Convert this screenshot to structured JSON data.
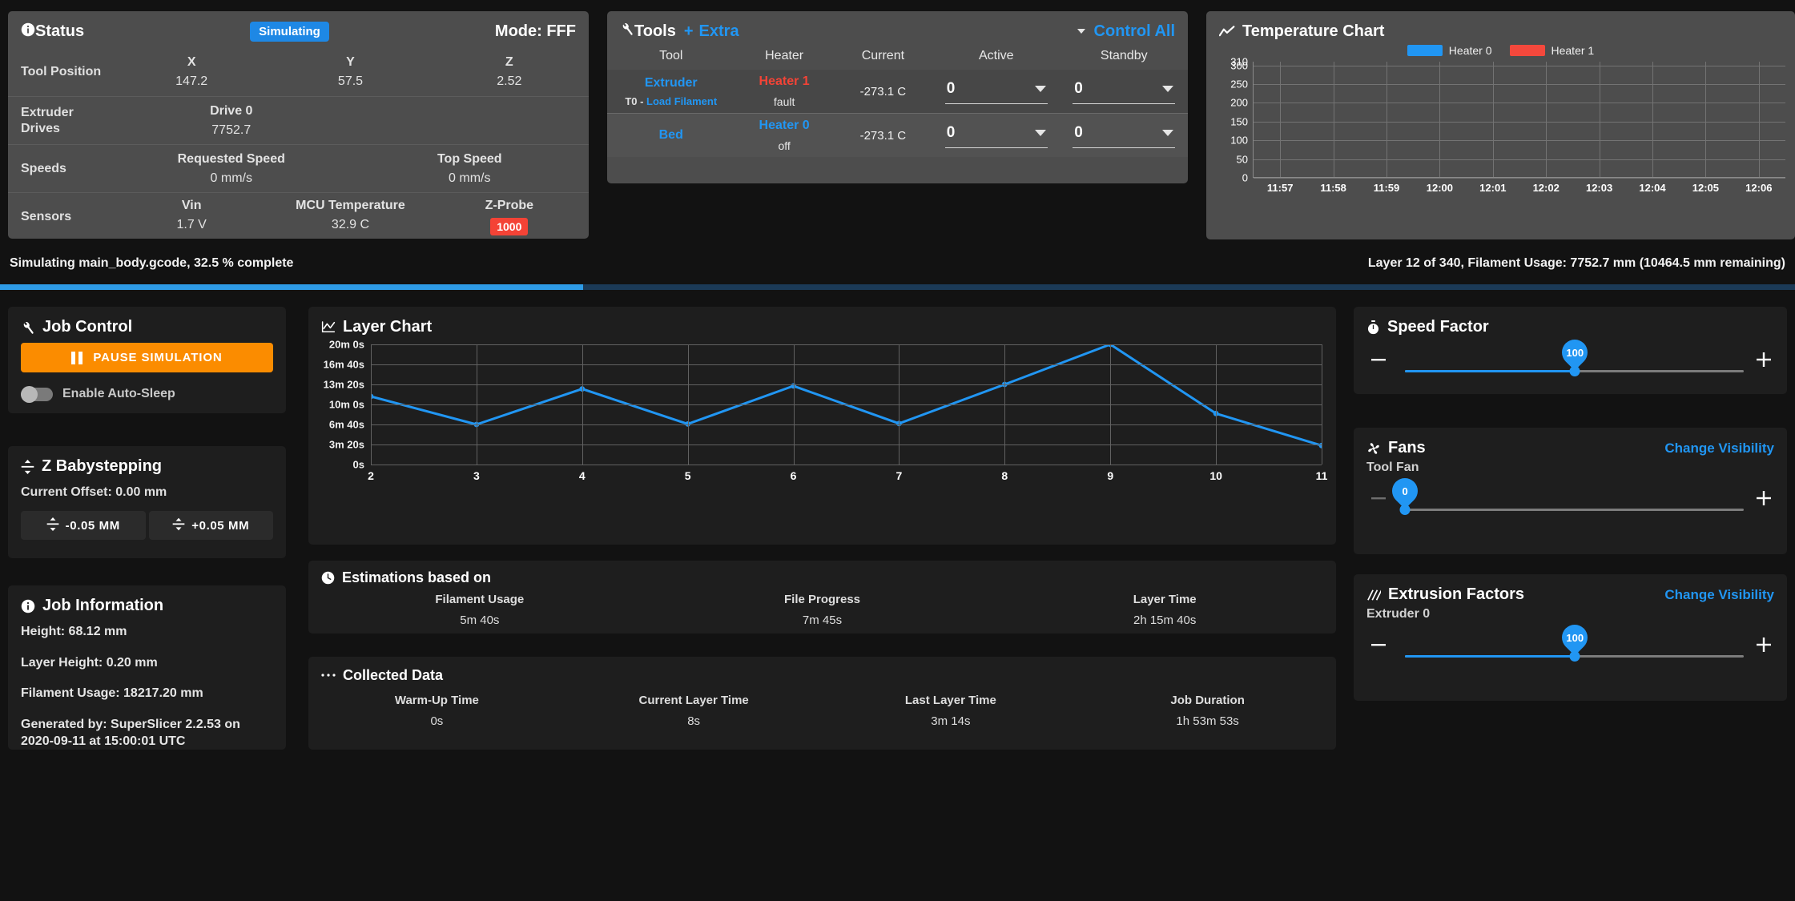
{
  "status": {
    "title": "Status",
    "badge": "Simulating",
    "mode": "Mode: FFF",
    "rows": [
      {
        "label": "Tool Position",
        "cells": [
          {
            "k": "X",
            "v": "147.2"
          },
          {
            "k": "Y",
            "v": "57.5"
          },
          {
            "k": "Z",
            "v": "2.52"
          }
        ]
      },
      {
        "label": "Extruder Drives",
        "label_line1": "Extruder",
        "label_line2": "Drives",
        "cells": [
          {
            "k": "Drive 0",
            "v": "7752.7"
          }
        ]
      },
      {
        "label": "Speeds",
        "cells": [
          {
            "k": "Requested Speed",
            "v": "0 mm/s"
          },
          {
            "k": "Top Speed",
            "v": "0 mm/s"
          }
        ]
      },
      {
        "label": "Sensors",
        "cells": [
          {
            "k": "Vin",
            "v": "1.7 V"
          },
          {
            "k": "MCU Temperature",
            "v": "32.9 C"
          },
          {
            "k": "Z-Probe",
            "v": "1000",
            "chip": "red"
          }
        ]
      }
    ]
  },
  "tools": {
    "title": "Tools",
    "extra_plus": "+",
    "extra": "Extra",
    "control_all": "Control All",
    "columns": [
      "Tool",
      "Heater",
      "Current",
      "Active",
      "Standby"
    ],
    "rows": [
      {
        "tool": "Extruder",
        "tool_sub_prefix": "T0 - ",
        "tool_sub_link": "Load Filament",
        "heater": "Heater 1",
        "heater_state": "fault",
        "heater_color": "red",
        "current": "-273.1 C",
        "active": "0",
        "standby": "0"
      },
      {
        "tool": "Bed",
        "tool_sub_prefix": "",
        "tool_sub_link": "",
        "heater": "Heater 0",
        "heater_state": "off",
        "heater_color": "blue",
        "current": "-273.1 C",
        "active": "0",
        "standby": "0"
      }
    ]
  },
  "temperature_chart": {
    "title": "Temperature Chart"
  },
  "progress": {
    "left": "Simulating main_body.gcode, 32.5 % complete",
    "right": "Layer 12 of 340, Filament Usage: 7752.7 mm (10464.5 mm remaining)",
    "percent": 32.5
  },
  "job_control": {
    "title": "Job Control",
    "pause_label": "PAUSE SIMULATION",
    "auto_sleep_label": "Enable Auto-Sleep",
    "auto_sleep_on": false
  },
  "z_babystepping": {
    "title": "Z Babystepping",
    "current_offset": "Current Offset: 0.00 mm",
    "minus_label": "-0.05 MM",
    "plus_label": "+0.05 MM"
  },
  "job_information": {
    "title": "Job Information",
    "lines": [
      "Height: 68.12 mm",
      "Layer Height: 0.20 mm",
      "Filament Usage: 18217.20 mm",
      "Generated by: SuperSlicer 2.2.53 on 2020-09-11 at 15:00:01 UTC"
    ]
  },
  "layer_chart": {
    "title": "Layer Chart"
  },
  "estimations": {
    "title": "Estimations based on",
    "stats": [
      {
        "k": "Filament Usage",
        "v": "5m 40s"
      },
      {
        "k": "File Progress",
        "v": "7m 45s"
      },
      {
        "k": "Layer Time",
        "v": "2h 15m 40s"
      }
    ]
  },
  "collected": {
    "title": "Collected Data",
    "stats": [
      {
        "k": "Warm-Up Time",
        "v": "0s"
      },
      {
        "k": "Current Layer Time",
        "v": "8s"
      },
      {
        "k": "Last Layer Time",
        "v": "3m 14s"
      },
      {
        "k": "Job Duration",
        "v": "1h 53m 53s"
      }
    ]
  },
  "speed_factor": {
    "title": "Speed Factor",
    "value": "100",
    "percent": 50
  },
  "fans": {
    "title": "Fans",
    "change_visibility": "Change Visibility",
    "items": [
      {
        "label": "Tool Fan",
        "value": "0",
        "percent": 0
      }
    ]
  },
  "extrusion_factors": {
    "title": "Extrusion Factors",
    "change_visibility": "Change Visibility",
    "items": [
      {
        "label": "Extruder 0",
        "value": "100",
        "percent": 50
      }
    ]
  },
  "colors": {
    "accent": "#2196f3",
    "warning": "#fb8c00",
    "danger": "#f44336",
    "heater0": "#2196f3",
    "heater1": "#f4483c",
    "panel_light": "#4d4d4d",
    "panel_dark": "#1e1e1e",
    "background": "#121212"
  },
  "chart_data": [
    {
      "type": "line",
      "title": "Layer Chart",
      "x": [
        2,
        3,
        4,
        5,
        6,
        7,
        8,
        9,
        10,
        11
      ],
      "values": [
        680,
        400,
        755,
        405,
        785,
        410,
        800,
        1200,
        510,
        190
      ],
      "series": [
        {
          "name": "Layer Time",
          "values": [
            680,
            400,
            755,
            405,
            785,
            410,
            800,
            1200,
            510,
            190
          ]
        }
      ],
      "xlabel": "",
      "ylabel": "",
      "xtick_labels": [
        "2",
        "3",
        "4",
        "5",
        "6",
        "7",
        "8",
        "9",
        "10",
        "11"
      ],
      "ytick_labels": [
        "0s",
        "3m 20s",
        "6m 40s",
        "10m 0s",
        "13m 20s",
        "16m 40s",
        "20m 0s"
      ],
      "ytick_values": [
        0,
        200,
        400,
        600,
        800,
        1000,
        1200
      ],
      "ylim": [
        0,
        1200
      ],
      "grid": true,
      "legend": "none",
      "line_color": "#2196f3"
    },
    {
      "type": "line",
      "title": "Temperature Chart",
      "x": [],
      "series": [
        {
          "name": "Heater 0",
          "color": "#2196f3",
          "values": []
        },
        {
          "name": "Heater 1",
          "color": "#f4483c",
          "values": []
        }
      ],
      "xtick_labels": [
        "11:57",
        "11:58",
        "11:59",
        "12:00",
        "12:01",
        "12:02",
        "12:03",
        "12:04",
        "12:05",
        "12:06"
      ],
      "ytick_labels": [
        "0",
        "50",
        "100",
        "150",
        "200",
        "250",
        "300",
        "310"
      ],
      "ytick_values": [
        0,
        50,
        100,
        150,
        200,
        250,
        300,
        310
      ],
      "ylim": [
        0,
        310
      ],
      "grid": true,
      "legend": "top-center",
      "xlabel": "",
      "ylabel": ""
    }
  ]
}
